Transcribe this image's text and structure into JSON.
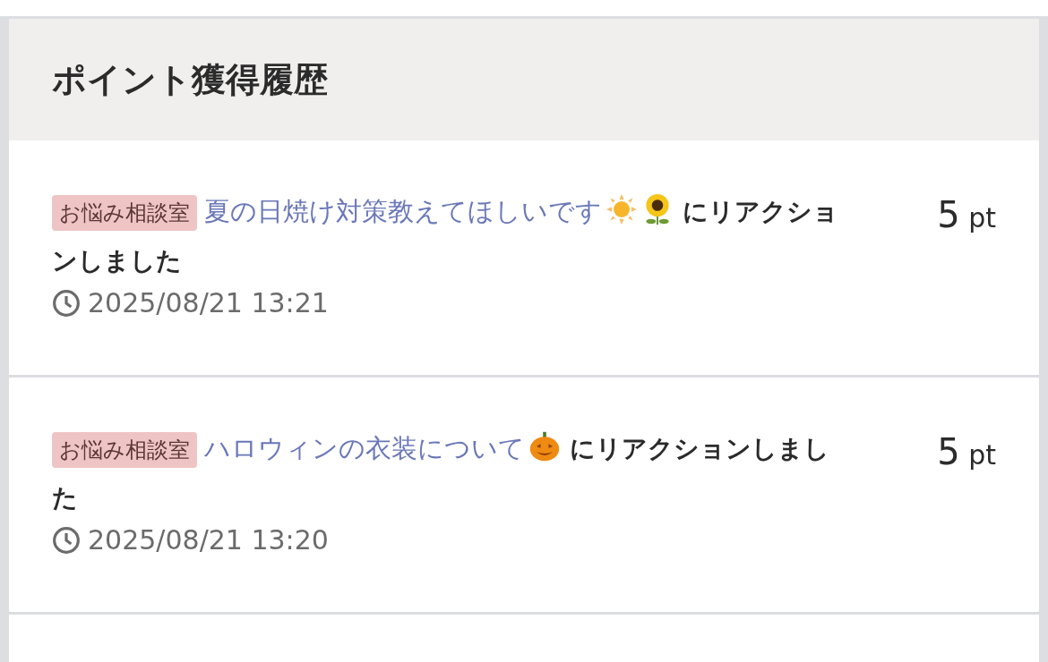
{
  "title": "ポイント獲得履歴",
  "items": [
    {
      "tag": "お悩み相談室",
      "link": "夏の日焼け対策教えてほしいです",
      "emoji": [
        {
          "kind": "sun"
        },
        {
          "kind": "sunflower"
        }
      ],
      "text": "にリアクションしました",
      "time": "2025/08/21 13:21",
      "points": "5",
      "unit": "pt"
    },
    {
      "tag": "お悩み相談室",
      "link": "ハロウィンの衣装について",
      "emoji": [
        {
          "kind": "pumpkin"
        }
      ],
      "text": "にリアクションしました",
      "time": "2025/08/21 13:20",
      "points": "5",
      "unit": "pt"
    }
  ]
}
